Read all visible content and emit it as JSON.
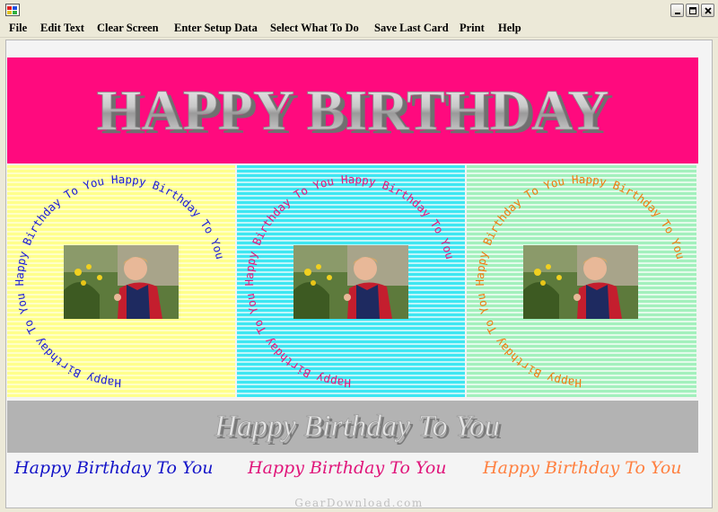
{
  "menu": {
    "items": [
      "File",
      "Edit Text",
      "Clear Screen",
      "Enter Setup Data",
      "Select What To Do",
      "Save Last Card",
      "Print",
      "Help"
    ]
  },
  "card": {
    "headline": "HAPPY BIRTHDAY",
    "circle_text": "Happy Birthday To You Happy Birthday To You Happy Birthday To You ",
    "panel_colors": {
      "yellow": "#ffff8c",
      "cyan": "#3ee6f2",
      "green": "#a3f0bd"
    },
    "circle_text_colors": {
      "yellow": "#1a1ad8",
      "cyan": "#e8147a",
      "green": "#f07a10"
    },
    "banner_color": "#ff0a7e",
    "greeting": "Happy Birthday To You",
    "script_lines": [
      {
        "text": "Happy Birthday To You",
        "color": "#1414c8"
      },
      {
        "text": "Happy Birthday To You",
        "color": "#e0147a"
      },
      {
        "text": "Happy Birthday To You",
        "color": "#ff8040"
      }
    ]
  },
  "watermark": "GearDownload.com",
  "icons": {
    "app": "app-icon",
    "minimize": "minimize-icon",
    "maximize": "maximize-icon",
    "close": "close-icon",
    "photo": "photo-icon"
  }
}
